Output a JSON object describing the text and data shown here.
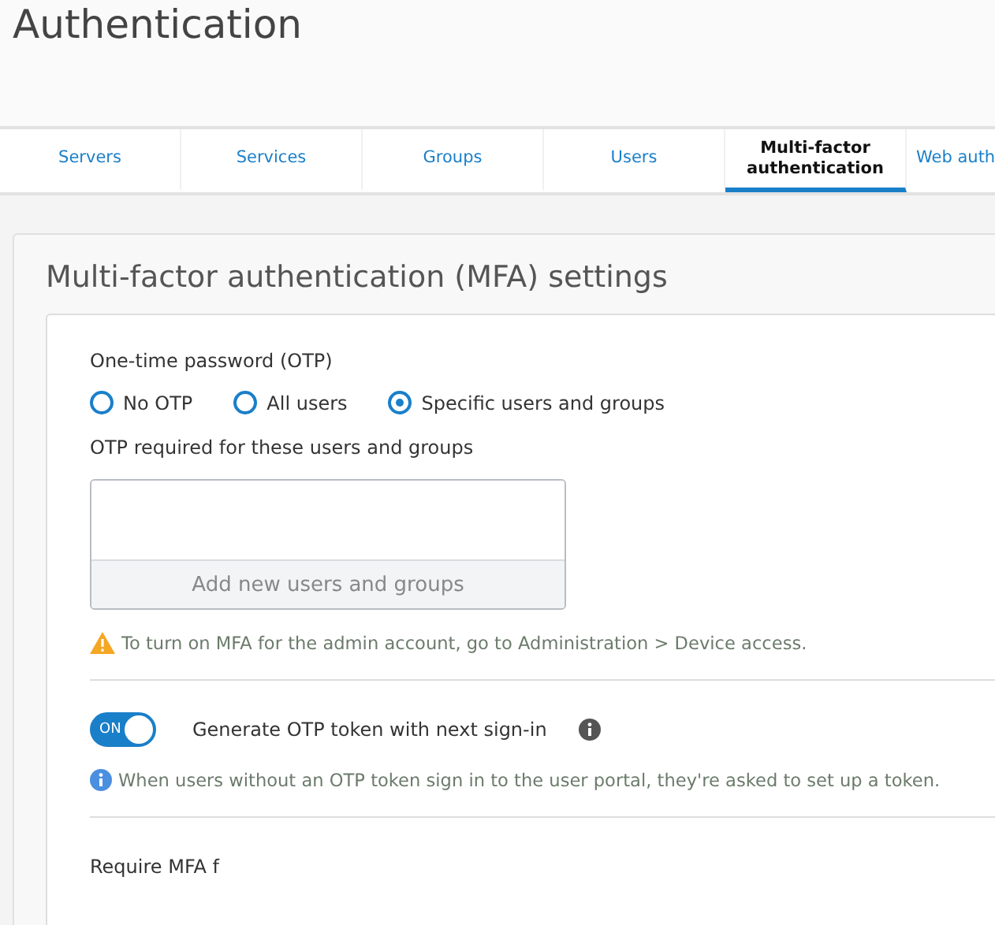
{
  "page": {
    "title": "Authentication"
  },
  "tabs": [
    {
      "label": "Servers",
      "selected": false
    },
    {
      "label": "Services",
      "selected": false
    },
    {
      "label": "Groups",
      "selected": false
    },
    {
      "label": "Users",
      "selected": false
    },
    {
      "label": "Multi-factor authentication",
      "selected": true
    },
    {
      "label": "Web auth",
      "selected": false
    }
  ],
  "section": {
    "title": "Multi-factor authentication (MFA) settings",
    "otp_label": "One-time password (OTP)",
    "otp_options": [
      {
        "label": "No OTP",
        "selected": false
      },
      {
        "label": "All users",
        "selected": false
      },
      {
        "label": "Specific users and groups",
        "selected": true
      }
    ],
    "required_label": "OTP required for these users and groups",
    "add_button": "Add new users and groups",
    "warning": "To turn on MFA for the admin account, go to Administration > Device access.",
    "toggle": {
      "on": true,
      "state_text": "ON",
      "label": "Generate OTP token with next sign-in"
    },
    "info": "When users without an OTP token sign in to the user portal, they're asked to set up a token.",
    "next_label": "Require MFA f"
  }
}
